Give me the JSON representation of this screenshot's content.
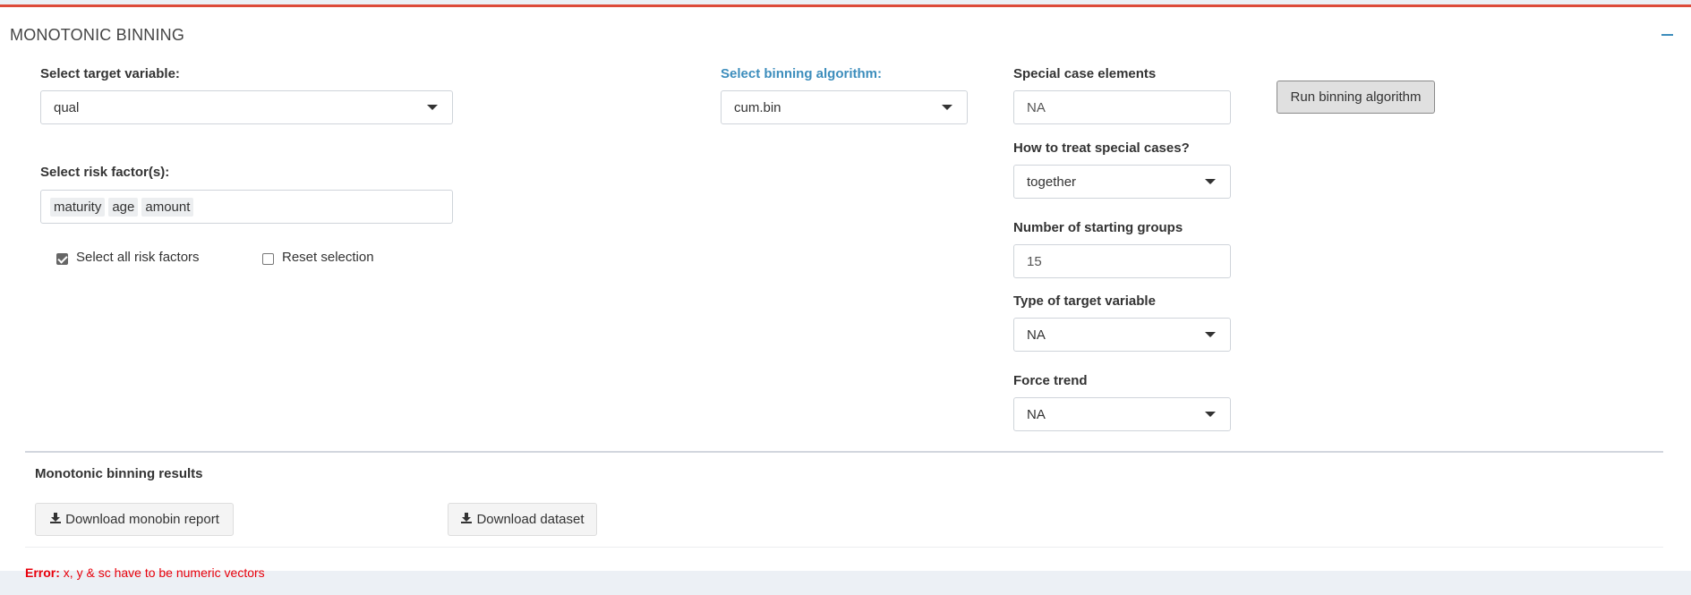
{
  "box": {
    "title": "MONOTONIC BINNING",
    "accent_color": "#dd4b39",
    "collapse_icon": "minus-icon"
  },
  "target": {
    "label": "Select target variable:",
    "value": "qual"
  },
  "risk_factors": {
    "label": "Select risk factor(s):",
    "tags": [
      "maturity",
      "age",
      "amount"
    ]
  },
  "checkboxes": {
    "select_all": {
      "label": "Select all risk factors",
      "checked": true
    },
    "reset": {
      "label": "Reset selection",
      "checked": false
    }
  },
  "algorithm": {
    "label": "Select binning algorithm:",
    "value": "cum.bin",
    "label_color": "#3c8dbc"
  },
  "special_case": {
    "label": "Special case elements",
    "value": "NA"
  },
  "treat_special": {
    "label": "How to treat special cases?",
    "value": "together"
  },
  "starting_groups": {
    "label": "Number of starting groups",
    "value": "15"
  },
  "target_type": {
    "label": "Type of target variable",
    "value": "NA"
  },
  "force_trend": {
    "label": "Force trend",
    "value": "NA"
  },
  "run_button": {
    "label": "Run binning algorithm"
  },
  "results": {
    "title": "Monotonic binning results",
    "download_report": "Download monobin report",
    "download_dataset": "Download dataset",
    "download_icon": "download-icon"
  },
  "error": {
    "prefix": "Error:",
    "message": "x, y & sc have to be numeric vectors",
    "color": "#e8000b"
  }
}
